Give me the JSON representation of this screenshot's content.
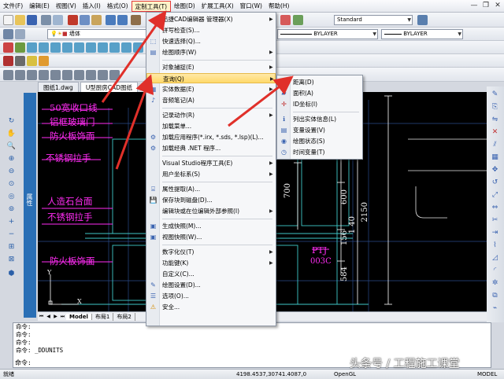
{
  "menubar": [
    "文件(F)",
    "编辑(E)",
    "视图(V)",
    "插入(I)",
    "格式(O)",
    "定制工具(T)",
    "绘图(D)",
    "扩展工具(X)",
    "窗口(W)",
    "帮助(H)"
  ],
  "window_controls": [
    "—",
    "❐",
    "✕"
  ],
  "toolbar": {
    "style_combo": "Standard",
    "layer_combo": "墙体",
    "linetype_combo": "BYLAYER",
    "lineweight_combo": "BYLAYER"
  },
  "doc_tabs": [
    "图纸1.dwg",
    "U型厨房CAD图纸"
  ],
  "property_panel": "属性",
  "canvas": {
    "labels": [
      "50宽收口线",
      "铝框玻璃门",
      "防火板饰面",
      "不锈钢拉手",
      "人造石台面",
      "不锈钢拉手",
      "防火板饰面"
    ],
    "dims": [
      "700",
      "600",
      "2150",
      "1 40",
      "156",
      "584"
    ],
    "tag_title": "PTJ",
    "tag_code": "003C",
    "ucs_x": "X",
    "ucs_y": "Y"
  },
  "layout_tabs": [
    "Model",
    "布局1",
    "布局2"
  ],
  "command_lines": [
    "命令:",
    "命令:",
    "命令:",
    "命令:  _DDUNITS",
    "命令:"
  ],
  "command_prompt": "命令:",
  "status": {
    "left": "就绪",
    "coords": "4198.4537,30741.4087,0",
    "renderer": "OpenGL",
    "model": "MODEL"
  },
  "watermark": "头条号 / 工程施工课堂",
  "menu_main": [
    {
      "label": "迅捷CAD编辑器 管理器(X)",
      "sub": true,
      "icon": ""
    },
    {
      "label": "拼写检查(S)...",
      "sub": false,
      "icon": "spell-icon"
    },
    {
      "label": "快速选择(Q)...",
      "sub": false,
      "icon": "quick-select-icon"
    },
    {
      "label": "绘图顺序(W)",
      "sub": true,
      "icon": "draw-order-icon"
    },
    {
      "label": "对象捕捉(E)",
      "sub": true,
      "icon": ""
    },
    {
      "label": "查询(Q)",
      "sub": true,
      "icon": "",
      "highlight": true
    },
    {
      "label": "实体数据(E)",
      "sub": true,
      "icon": "entity-data-icon"
    },
    {
      "label": "音频笔记(A)",
      "sub": false,
      "icon": "audio-icon"
    },
    {
      "label": "记录动作(R)",
      "sub": true,
      "icon": ""
    },
    {
      "label": "加载菜单...",
      "sub": false,
      "icon": ""
    },
    {
      "label": "加载应用程序(*.irx, *.sds, *.lsp)(L)...",
      "sub": false,
      "icon": "load-app-icon"
    },
    {
      "label": "加载经典 .NET 程序...",
      "sub": false,
      "icon": "load-net-icon"
    },
    {
      "label": "Visual Studio程序工具(E)",
      "sub": true,
      "icon": ""
    },
    {
      "label": "用户坐标系(S)",
      "sub": true,
      "icon": ""
    },
    {
      "label": "属性提取(A)...",
      "sub": false,
      "icon": "attr-extract-icon"
    },
    {
      "label": "保存块到磁盘(D)...",
      "sub": false,
      "icon": "save-block-icon"
    },
    {
      "label": "编辑块或在位编辑外部参照(I)",
      "sub": true,
      "icon": ""
    },
    {
      "label": "生成快照(M)...",
      "sub": false,
      "icon": "snapshot-icon"
    },
    {
      "label": "视图快照(W)...",
      "sub": false,
      "icon": "view-snapshot-icon"
    },
    {
      "label": "数字化仪(T)",
      "sub": true,
      "icon": ""
    },
    {
      "label": "功能键(K)",
      "sub": true,
      "icon": ""
    },
    {
      "label": "自定义(C)...",
      "sub": false,
      "icon": ""
    },
    {
      "label": "绘图设置(D)...",
      "sub": false,
      "icon": "draw-settings-icon"
    },
    {
      "label": "选项(O)...",
      "sub": false,
      "icon": "options-icon"
    },
    {
      "label": "安全...",
      "sub": false,
      "icon": "security-icon"
    }
  ],
  "menu_query": [
    {
      "label": "距离(D)",
      "icon": "distance-icon"
    },
    {
      "label": "面积(A)",
      "icon": "area-icon"
    },
    {
      "label": "ID坐标(I)",
      "icon": "id-coord-icon"
    },
    {
      "label": "列出实体信息(L)",
      "icon": "list-icon"
    },
    {
      "label": "变量设置(V)",
      "icon": "variable-icon"
    },
    {
      "label": "绘图状态(S)",
      "icon": "draw-status-icon"
    },
    {
      "label": "时间变量(T)",
      "icon": "time-icon"
    }
  ]
}
